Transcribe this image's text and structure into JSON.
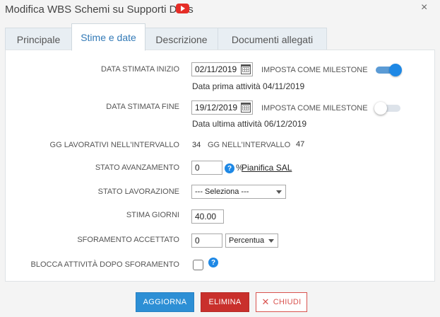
{
  "window": {
    "title": "Modifica WBS Schemi su Supporti Docs",
    "close_label": "×"
  },
  "tabs": [
    {
      "label": "Principale",
      "active": false
    },
    {
      "label": "Stime e date",
      "active": true
    },
    {
      "label": "Descrizione",
      "active": false
    },
    {
      "label": "Documenti allegati",
      "active": false
    }
  ],
  "form": {
    "start_date": {
      "label": "DATA STIMATA INIZIO",
      "value": "02/11/2019",
      "milestone_label": "IMPOSTA COME MILESTONE",
      "milestone_on": true,
      "info": "Data prima attività 04/11/2019"
    },
    "end_date": {
      "label": "DATA STIMATA FINE",
      "value": "19/12/2019",
      "milestone_label": "IMPOSTA COME MILESTONE",
      "milestone_on": false,
      "info": "Data ultima attività 06/12/2019"
    },
    "working_days": {
      "label": "GG LAVORATIVI NELL'INTERVALLO",
      "value": "34",
      "total_label": "GG NELL'INTERVALLO",
      "total_value": "47"
    },
    "progress": {
      "label": "STATO AVANZAMENTO",
      "value": "0",
      "unit": "%",
      "link": "Pianifica SAL",
      "help": "?"
    },
    "work_status": {
      "label": "STATO LAVORAZIONE",
      "selected": "--- Seleziona ---"
    },
    "estimate_days": {
      "label": "STIMA GIORNI",
      "value": "40.00"
    },
    "overrun": {
      "label": "SFORAMENTO ACCETTATO",
      "value": "0",
      "type_selected": "Percentua"
    },
    "block_after_overrun": {
      "label": "BLOCCA ATTIVITÀ DOPO SFORAMENTO",
      "checked": false,
      "help": "?"
    }
  },
  "buttons": {
    "update": "AGGIORNA",
    "delete": "ELIMINA",
    "close": "CHIUDI",
    "close_icon": "✕"
  },
  "colors": {
    "primary": "#2d8fd5",
    "danger": "#c9302c",
    "toggle_on": "#1e88e5"
  }
}
